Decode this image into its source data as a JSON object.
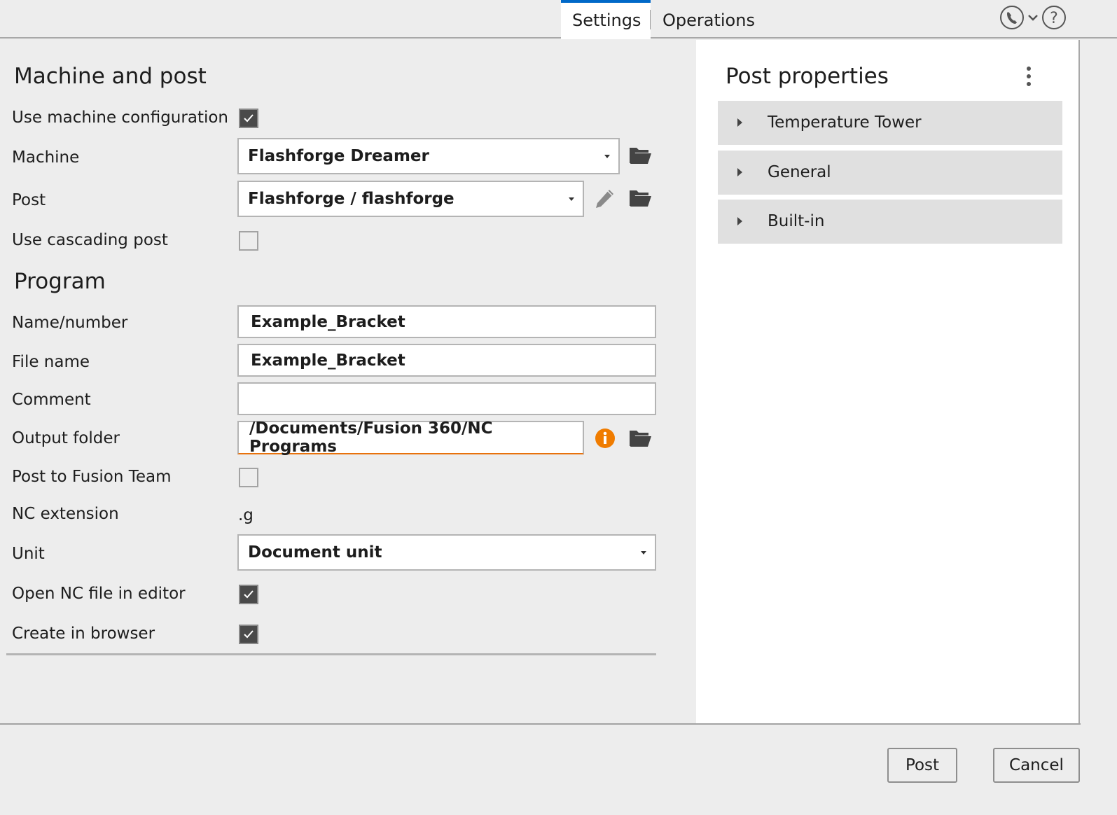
{
  "tabs": [
    {
      "label": "Settings",
      "active": true
    },
    {
      "label": "Operations",
      "active": false
    }
  ],
  "top_icons": [
    "phone-icon",
    "chevron-down-icon",
    "help-icon"
  ],
  "machine_and_post": {
    "title": "Machine and post",
    "use_machine_configuration": {
      "label": "Use machine configuration",
      "checked": true
    },
    "machine": {
      "label": "Machine",
      "value": "Flashforge Dreamer"
    },
    "post": {
      "label": "Post",
      "value": "Flashforge / flashforge"
    },
    "use_cascading_post": {
      "label": "Use cascading post",
      "checked": false
    }
  },
  "program": {
    "title": "Program",
    "name_number": {
      "label": "Name/number",
      "value": "Example_Bracket"
    },
    "file_name": {
      "label": "File name",
      "value": "Example_Bracket"
    },
    "comment": {
      "label": "Comment",
      "value": ""
    },
    "output_folder": {
      "label": "Output folder",
      "value": "/Documents/Fusion 360/NC Programs"
    },
    "post_to_fusion_team": {
      "label": "Post to Fusion Team",
      "checked": false
    },
    "nc_extension": {
      "label": "NC extension",
      "value": ".g"
    },
    "unit": {
      "label": "Unit",
      "value": "Document unit"
    },
    "open_nc_in_editor": {
      "label": "Open NC file in editor",
      "checked": true
    },
    "create_in_browser": {
      "label": "Create in browser",
      "checked": true
    }
  },
  "post_properties": {
    "title": "Post properties",
    "groups": [
      {
        "label": "Temperature Tower"
      },
      {
        "label": "General"
      },
      {
        "label": "Built-in"
      }
    ]
  },
  "footer": {
    "post_label": "Post",
    "cancel_label": "Cancel"
  },
  "colors": {
    "accent": "#0068c8",
    "warning": "#e8720c"
  }
}
